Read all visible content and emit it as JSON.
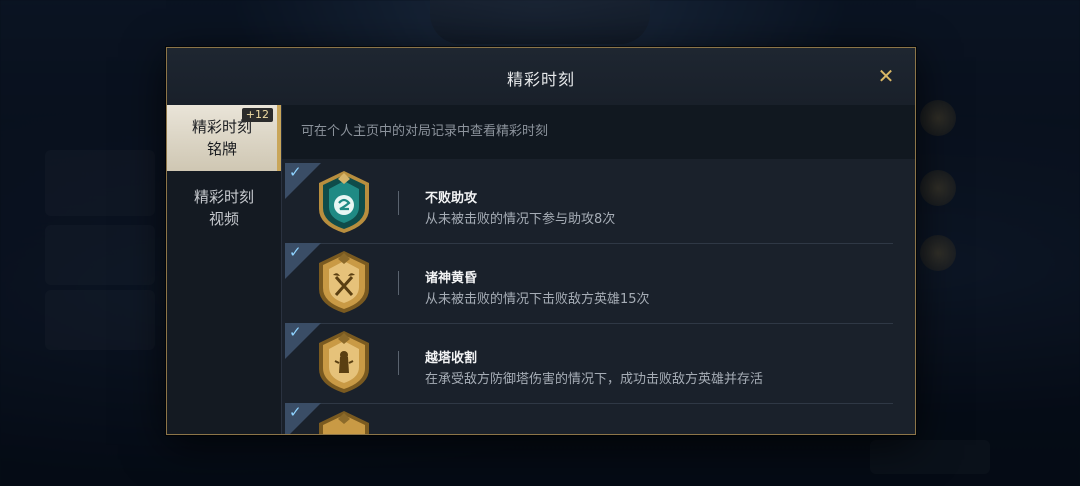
{
  "modal": {
    "title": "精彩时刻",
    "close_icon": "close-icon"
  },
  "sidebar": {
    "tabs": [
      {
        "label": "精彩时刻铭牌",
        "line1": "精彩时刻",
        "line2": "铭牌",
        "badge": "+12",
        "active": true
      },
      {
        "label": "精彩时刻视频",
        "line1": "精彩时刻",
        "line2": "视频",
        "active": false
      }
    ]
  },
  "content": {
    "hint": "可在个人主页中的对局记录中查看精彩时刻",
    "achievements": [
      {
        "title": "不败助攻",
        "desc": "从未被击败的情况下参与助攻8次",
        "medal": "teal-medal-icon",
        "completed": true
      },
      {
        "title": "诸神黄昏",
        "desc": "从未被击败的情况下击败敌方英雄15次",
        "medal": "gold-axes-medal-icon",
        "completed": true
      },
      {
        "title": "越塔收割",
        "desc": "在承受敌方防御塔伤害的情况下，成功击败敌方英雄并存活",
        "medal": "gold-tower-medal-icon",
        "completed": true
      },
      {
        "title": "",
        "desc": "",
        "medal": "gold-medal-icon",
        "completed": true
      }
    ]
  },
  "colors": {
    "accent_gold": "#c9a65a",
    "border_gold": "#8c7549",
    "check_blue": "#8fd3ff"
  }
}
